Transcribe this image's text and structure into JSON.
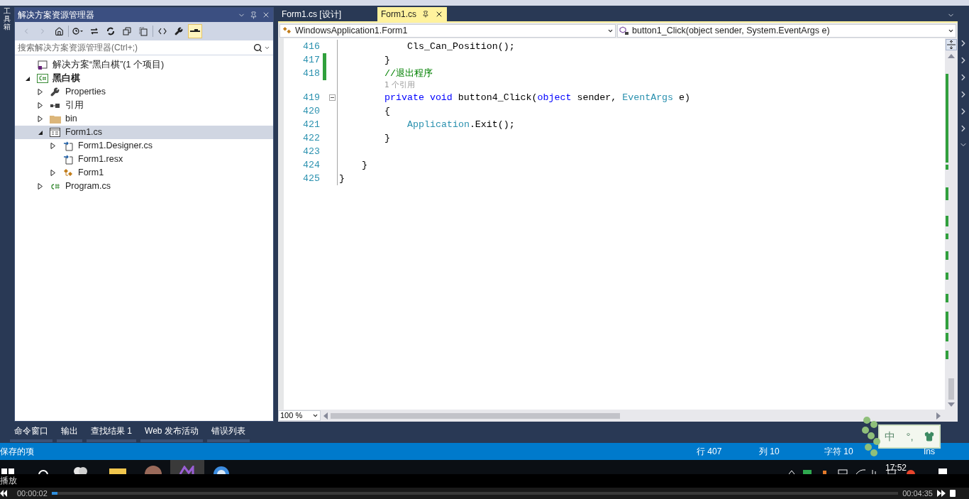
{
  "toolbox_strip": {
    "label": "工具箱"
  },
  "solution_explorer": {
    "title": "解决方案资源管理器",
    "search": {
      "placeholder": "搜索解决方案资源管理器(Ctrl+;)"
    },
    "tree": [
      {
        "label": "解决方案“黑白棋”(1 个项目)",
        "kind": "solution",
        "selected": false,
        "children": [
          {
            "label": "黑白棋",
            "kind": "project",
            "bold": true,
            "expanded": true,
            "selected": false,
            "children": [
              {
                "label": "Properties",
                "kind": "properties",
                "expanded": false,
                "selected": false
              },
              {
                "label": "引用",
                "kind": "references",
                "expanded": false,
                "selected": false
              },
              {
                "label": "bin",
                "kind": "folder",
                "expanded": false,
                "selected": false
              },
              {
                "label": "Form1.cs",
                "kind": "form",
                "expanded": true,
                "selected": true,
                "children": [
                  {
                    "label": "Form1.Designer.cs",
                    "kind": "file",
                    "expanded": false,
                    "selected": false
                  },
                  {
                    "label": "Form1.resx",
                    "kind": "file",
                    "selected": false
                  },
                  {
                    "label": "Form1",
                    "kind": "class",
                    "expanded": false,
                    "selected": false
                  }
                ]
              },
              {
                "label": "Program.cs",
                "kind": "csharp",
                "expanded": false,
                "selected": false
              }
            ]
          }
        ]
      }
    ]
  },
  "editor": {
    "tabs": [
      {
        "label": "Form1.cs [设计]",
        "selected": false
      },
      {
        "label": "Form1.cs",
        "selected": true
      }
    ],
    "type_dropdown": "WindowsApplication1.Form1",
    "member_dropdown": "button1_Click(object sender, System.EventArgs e)",
    "lines": [
      {
        "number": "416",
        "changed": false,
        "fold": false,
        "segments": [
          {
            "text": "            Cls_Can_Position();",
            "kind": "plain"
          }
        ]
      },
      {
        "number": "417",
        "changed": true,
        "fold": false,
        "segments": [
          {
            "text": "        }",
            "kind": "plain"
          }
        ]
      },
      {
        "number": "418",
        "changed": true,
        "fold": false,
        "segments": [
          {
            "text": "        //退出程序",
            "kind": "comment"
          }
        ]
      },
      {
        "changed": false,
        "fold": false,
        "segments": [
          {
            "text": "        1 个引用",
            "kind": "lens"
          }
        ]
      },
      {
        "number": "419",
        "changed": false,
        "fold": true,
        "segments": [
          {
            "text": "        private void",
            "kind": "keyword"
          },
          {
            "text": " button4_Click(",
            "kind": "plain"
          },
          {
            "text": "object",
            "kind": "keyword"
          },
          {
            "text": " sender, ",
            "kind": "plain"
          },
          {
            "text": "EventArgs",
            "kind": "type"
          },
          {
            "text": " e)",
            "kind": "plain"
          }
        ]
      },
      {
        "number": "420",
        "changed": false,
        "fold": false,
        "segments": [
          {
            "text": "        {",
            "kind": "plain"
          }
        ]
      },
      {
        "number": "421",
        "changed": false,
        "fold": false,
        "segments": [
          {
            "text": "            Application",
            "kind": "type"
          },
          {
            "text": ".Exit();",
            "kind": "plain"
          }
        ]
      },
      {
        "number": "422",
        "changed": false,
        "fold": false,
        "segments": [
          {
            "text": "        }",
            "kind": "plain"
          }
        ]
      },
      {
        "number": "423",
        "changed": false,
        "fold": false
      },
      {
        "number": "424",
        "changed": false,
        "fold": false,
        "segments": [
          {
            "text": "    }",
            "kind": "plain"
          }
        ]
      },
      {
        "number": "425",
        "changed": false,
        "fold": false,
        "segments": [
          {
            "text": "}",
            "kind": "plain"
          }
        ]
      }
    ],
    "zoom": "100 %"
  },
  "bottom_tabs": [
    "命令窗口",
    "输出",
    "查找结果 1",
    "Web 发布活动",
    "错误列表"
  ],
  "status_bar": {
    "message": "保存的项",
    "line": "行 407",
    "column": "列 10",
    "char": "字符 10",
    "mode": "Ins"
  },
  "ime": {
    "language": "中",
    "punctuation": "°,"
  },
  "taskbar": {
    "clock": "17:52"
  },
  "player": {
    "label": "播放",
    "elapsed": "00:00:02",
    "total": "00:04:35",
    "level": 0.004
  }
}
